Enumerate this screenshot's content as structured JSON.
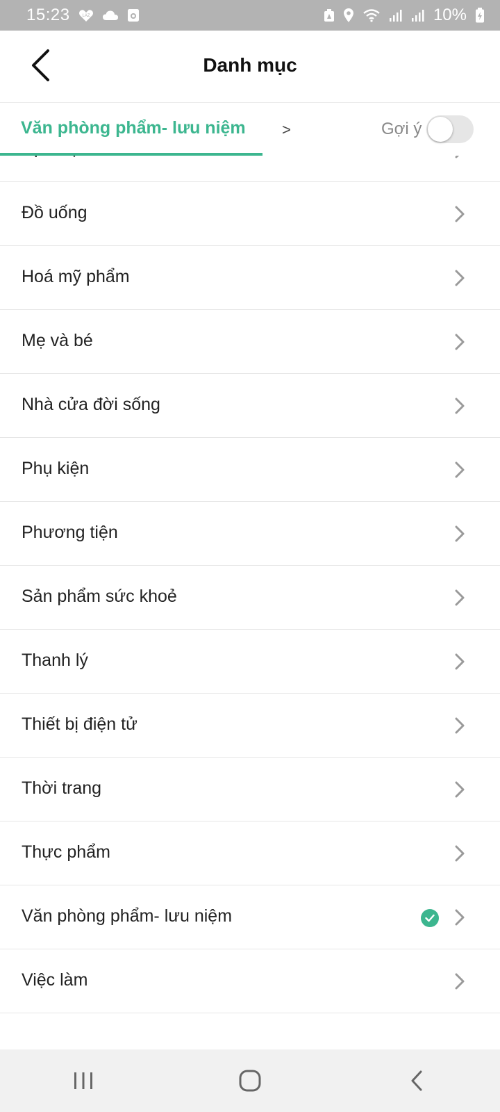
{
  "status_bar": {
    "time": "15:23",
    "battery": "10%",
    "left_icons": [
      "lazada-icon",
      "cloud-icon",
      "camera-app-icon"
    ],
    "right_icons": [
      "alarm-icon",
      "location-icon",
      "wifi-icon",
      "signal-icon",
      "signal-icon",
      "battery-charging-icon"
    ]
  },
  "header": {
    "title": "Danh mục",
    "back_icon": "back-chevron-icon"
  },
  "breadcrumb": {
    "active": "Văn phòng phẩm- lưu niệm",
    "separator": ">",
    "suggest_label": "Gợi ý",
    "suggest_enabled": false,
    "accent_color": "#3cb68f"
  },
  "categories": [
    {
      "label": "Dịch vụ",
      "selected": false
    },
    {
      "label": "Đồ uống",
      "selected": false
    },
    {
      "label": "Hoá mỹ phẩm",
      "selected": false
    },
    {
      "label": "Mẹ và bé",
      "selected": false
    },
    {
      "label": "Nhà cửa đời sống",
      "selected": false
    },
    {
      "label": "Phụ kiện",
      "selected": false
    },
    {
      "label": "Phương tiện",
      "selected": false
    },
    {
      "label": "Sản phẩm sức khoẻ",
      "selected": false
    },
    {
      "label": "Thanh lý",
      "selected": false
    },
    {
      "label": "Thiết bị điện tử",
      "selected": false
    },
    {
      "label": "Thời trang",
      "selected": false
    },
    {
      "label": "Thực phẩm",
      "selected": false
    },
    {
      "label": "Văn phòng phẩm- lưu niệm",
      "selected": true
    },
    {
      "label": "Việc làm",
      "selected": false
    }
  ],
  "nav_bar": {
    "buttons": [
      "recent-apps-icon",
      "home-icon",
      "back-icon"
    ]
  }
}
